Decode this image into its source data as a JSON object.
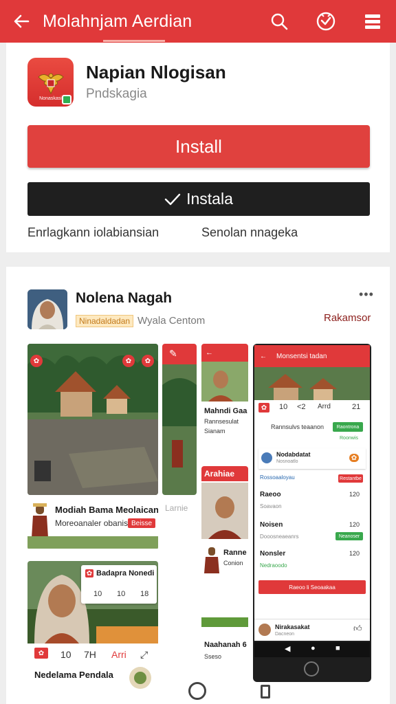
{
  "appbar": {
    "title": "Molahnjam Aerdian",
    "icons": [
      "back-arrow-icon",
      "search-icon",
      "verified-badge-icon",
      "menu-icon"
    ]
  },
  "app": {
    "name": "Napian Nlogisan",
    "publisher": "Pndskagia",
    "icon_caption": "Nonaskasi",
    "install_label": "Install",
    "installed_label": "Instala",
    "link_left": "Enrlagkann iolabiansian",
    "link_right": "Senolan nnageka"
  },
  "developer": {
    "name": "Nolenа Nagah",
    "badge": "Ninadaldadan",
    "subtitle": "Wyala Centom",
    "link": "Rakamsor"
  },
  "screens": {
    "card1_caption": "Modiah Bama Meolaican",
    "card1_sub": "Moreoanaler obanis",
    "card1_chip": "Beisse",
    "card2_overlay_title": "Badapra Nonedi",
    "card2_overlay_nums": [
      "10",
      "10",
      "18"
    ],
    "card2_tabs": [
      "10",
      "7H",
      "Arri"
    ],
    "card2_caption": "Nedelama Pendala",
    "strip_label": "Larnie",
    "col3_top_title": "Mahndi Gaa",
    "col3_top_sub": "Rannsesulat",
    "col3_top_sub2": "Sianam",
    "col3_banner": "Arahiae",
    "col3_mid_title": "Ranne",
    "col3_mid_sub": "Conion",
    "col3_bottom_title": "Naahanah 6",
    "col3_bottom_sub": "Sseso",
    "phone_title": "Monsentsi tadan",
    "phone_tabs": [
      "10",
      "<2",
      "Arrd",
      "21"
    ],
    "phone_row1": "Rannsulvs teaanon",
    "phone_row1_btn": "Raontrona",
    "phone_row1_sub": "Roonwis",
    "phone_row2_title": "Nodabdatat",
    "phone_row2_sub": "Nosnoatlo",
    "phone_row3": "Rossoaaloyau",
    "phone_row3_chip": "Restantbe",
    "phone_row4_title": "Raeoo",
    "phone_row4_val": "120",
    "phone_row4_sub": "Soavaon",
    "phone_row5_title": "Noisen",
    "phone_row5_val": "120",
    "phone_row5_sub": "Dooosneaeanrs",
    "phone_row5_chip": "Neanoser",
    "phone_row6_title": "Nonsler",
    "phone_row6_val": "120",
    "phone_row6_sub": "Nedraoodo",
    "phone_button": "Raeoo li Seoaakaa",
    "phone_bottom_title": "Nirakasakat",
    "phone_bottom_sub": "Dacneon"
  }
}
